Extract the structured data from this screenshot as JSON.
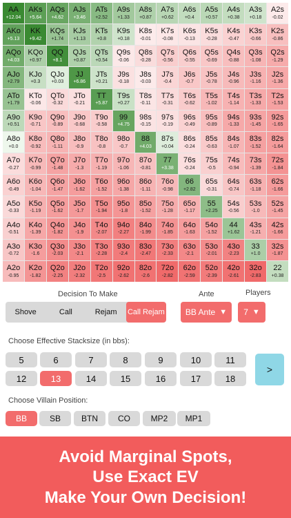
{
  "hands": [
    [
      "AA",
      "+12.04"
    ],
    [
      "AKs",
      "+5.64"
    ],
    [
      "AQs",
      "+4.62"
    ],
    [
      "AJs",
      "+3.46"
    ],
    [
      "ATs",
      "+2.52"
    ],
    [
      "A9s",
      "+1.33"
    ],
    [
      "A8s",
      "+0.87"
    ],
    [
      "A7s",
      "+0.62"
    ],
    [
      "A6s",
      "+0.4"
    ],
    [
      "A5s",
      "+0.57"
    ],
    [
      "A4s",
      "+0.38"
    ],
    [
      "A3s",
      "+0.18"
    ],
    [
      "A2s",
      "-0.02"
    ],
    [
      "AKo",
      "+5.13"
    ],
    [
      "KK",
      "+9.42"
    ],
    [
      "KQs",
      "+1.74"
    ],
    [
      "KJs",
      "+1.13"
    ],
    [
      "KTs",
      "+0.8"
    ],
    [
      "K9s",
      "+0.18"
    ],
    [
      "K8s",
      "-0.01"
    ],
    [
      "K7s",
      "-0.08"
    ],
    [
      "K6s",
      "-0.13"
    ],
    [
      "K5s",
      "-0.28"
    ],
    [
      "K4s",
      "-0.47"
    ],
    [
      "K3s",
      "-0.66"
    ],
    [
      "K2s",
      "-0.86"
    ],
    [
      "AQo",
      "+4.03"
    ],
    [
      "KQo",
      "+0.97"
    ],
    [
      "QQ",
      "+8.1"
    ],
    [
      "QJs",
      "+0.87"
    ],
    [
      "QTs",
      "+0.54"
    ],
    [
      "Q9s",
      "-0.06"
    ],
    [
      "Q8s",
      "-0.28"
    ],
    [
      "Q7s",
      "-0.56"
    ],
    [
      "Q6s",
      "-0.55"
    ],
    [
      "Q5s",
      "-0.69"
    ],
    [
      "Q4s",
      "-0.88"
    ],
    [
      "Q3s",
      "-1.08"
    ],
    [
      "Q2s",
      "-1.29"
    ],
    [
      "AJo",
      "+2.79"
    ],
    [
      "KJo",
      "+0.3"
    ],
    [
      "QJo",
      "+0.03"
    ],
    [
      "JJ",
      "+6.86"
    ],
    [
      "JTs",
      "+0.21"
    ],
    [
      "J9s",
      "-0.18"
    ],
    [
      "J8s",
      "-0.03"
    ],
    [
      "J7s",
      "-0.4"
    ],
    [
      "J6s",
      "-0.7"
    ],
    [
      "J5s",
      "-0.78"
    ],
    [
      "J4s",
      "-0.96"
    ],
    [
      "J3s",
      "-1.16"
    ],
    [
      "J2s",
      "-1.36"
    ],
    [
      "ATo",
      "+1.79"
    ],
    [
      "KTo",
      "-0.06"
    ],
    [
      "QTo",
      "-0.32"
    ],
    [
      "JTo",
      "-0.21"
    ],
    [
      "TT",
      "+5.87"
    ],
    [
      "T9s",
      "+0.27"
    ],
    [
      "T8s",
      "-0.11"
    ],
    [
      "T7s",
      "-0.31"
    ],
    [
      "T6s",
      "-0.62"
    ],
    [
      "T5s",
      "-1.02"
    ],
    [
      "T4s",
      "-1.14"
    ],
    [
      "T3s",
      "-1.33"
    ],
    [
      "T2s",
      "-1.53"
    ],
    [
      "A9o",
      "+0.51"
    ],
    [
      "K9o",
      "-0.71"
    ],
    [
      "Q9o",
      "-0.89"
    ],
    [
      "J9o",
      "-0.68"
    ],
    [
      "T9o",
      "-0.58"
    ],
    [
      "99",
      "+4.75"
    ],
    [
      "98s",
      "-0.15"
    ],
    [
      "97s",
      "-0.19"
    ],
    [
      "96s",
      "-0.49"
    ],
    [
      "95s",
      "-0.89"
    ],
    [
      "94s",
      "-1.33"
    ],
    [
      "93s",
      "-1.45"
    ],
    [
      "92s",
      "-1.65"
    ],
    [
      "A8o",
      "+0.0"
    ],
    [
      "K8o",
      "-0.92"
    ],
    [
      "Q8o",
      "-1.11"
    ],
    [
      "J8o",
      "-0.9"
    ],
    [
      "T8o",
      "-0.8"
    ],
    [
      "98o",
      "-0.7"
    ],
    [
      "88",
      "+4.03"
    ],
    [
      "87s",
      "+0.04"
    ],
    [
      "86s",
      "-0.24"
    ],
    [
      "85s",
      "-0.63"
    ],
    [
      "84s",
      "-1.07"
    ],
    [
      "83s",
      "-1.52"
    ],
    [
      "82s",
      "-1.64"
    ],
    [
      "A7o",
      "-0.27"
    ],
    [
      "K7o",
      "-0.99"
    ],
    [
      "Q7o",
      "-1.48"
    ],
    [
      "J7o",
      "-1.3"
    ],
    [
      "T7o",
      "-1.19"
    ],
    [
      "97o",
      "-1.06"
    ],
    [
      "87o",
      "-0.81"
    ],
    [
      "77",
      "+3.38"
    ],
    [
      "76s",
      "-0.24"
    ],
    [
      "75s",
      "-0.5"
    ],
    [
      "74s",
      "-0.94"
    ],
    [
      "73s",
      "-1.39"
    ],
    [
      "72s",
      "-1.84"
    ],
    [
      "A6o",
      "-0.49"
    ],
    [
      "K6o",
      "-1.04"
    ],
    [
      "Q6o",
      "-1.47"
    ],
    [
      "J6o",
      "-1.62"
    ],
    [
      "T6o",
      "-1.52"
    ],
    [
      "96o",
      "-1.38"
    ],
    [
      "86o",
      "-1.11"
    ],
    [
      "76o",
      "-0.98"
    ],
    [
      "66",
      "+2.82"
    ],
    [
      "65s",
      "-0.31"
    ],
    [
      "64s",
      "-0.74"
    ],
    [
      "63s",
      "-1.18"
    ],
    [
      "62s",
      "-1.66"
    ],
    [
      "A5o",
      "-0.33"
    ],
    [
      "K5o",
      "-1.19"
    ],
    [
      "Q5o",
      "-1.62"
    ],
    [
      "J5o",
      "-1.7"
    ],
    [
      "T5o",
      "-1.94"
    ],
    [
      "95o",
      "-1.8"
    ],
    [
      "85o",
      "-1.52"
    ],
    [
      "75o",
      "-1.28"
    ],
    [
      "65o",
      "-1.17"
    ],
    [
      "55",
      "+2.25"
    ],
    [
      "54s",
      "-0.56"
    ],
    [
      "53s",
      "-1.0"
    ],
    [
      "52s",
      "-1.45"
    ],
    [
      "A4o",
      "-0.51"
    ],
    [
      "K4o",
      "-1.39"
    ],
    [
      "Q4o",
      "-1.82"
    ],
    [
      "J4o",
      "-1.9"
    ],
    [
      "T4o",
      "-2.07"
    ],
    [
      "94o",
      "-2.27"
    ],
    [
      "84o",
      "-1.99"
    ],
    [
      "74o",
      "-1.85"
    ],
    [
      "64o",
      "-1.63"
    ],
    [
      "54o",
      "-1.52"
    ],
    [
      "44",
      "+1.62"
    ],
    [
      "43s",
      "-1.21"
    ],
    [
      "42s",
      "-1.66"
    ],
    [
      "A3o",
      "-0.72"
    ],
    [
      "K3o",
      "-1.6"
    ],
    [
      "Q3o",
      "-2.03"
    ],
    [
      "J3o",
      "-2.1"
    ],
    [
      "T3o",
      "-2.28"
    ],
    [
      "93o",
      "-2.4"
    ],
    [
      "83o",
      "-2.47"
    ],
    [
      "73o",
      "-2.33"
    ],
    [
      "63o",
      "-2.1"
    ],
    [
      "53o",
      "-2.01"
    ],
    [
      "43o",
      "-2.23"
    ],
    [
      "33",
      "+1.0"
    ],
    [
      "32s",
      "-1.87"
    ],
    [
      "A2o",
      "-0.95"
    ],
    [
      "K2o",
      "-1.82"
    ],
    [
      "Q2o",
      "-2.25"
    ],
    [
      "J2o",
      "-2.32"
    ],
    [
      "T2o",
      "-2.5"
    ],
    [
      "92o",
      "-2.62"
    ],
    [
      "82o",
      "-2.6"
    ],
    [
      "72o",
      "-2.82"
    ],
    [
      "62o",
      "-2.59"
    ],
    [
      "52o",
      "-2.39"
    ],
    [
      "42o",
      "-2.61"
    ],
    [
      "32o",
      "-2.83"
    ],
    [
      "22",
      "+0.38"
    ]
  ],
  "labels": {
    "decision": "Decision To Make",
    "ante": "Ante",
    "players": "Players",
    "stacksize": "Choose Effective Stacksize (in bbs):",
    "villain": "Choose Villain Position:"
  },
  "decision_options": [
    "Shove",
    "Call",
    "Rejam",
    "Call Rejam"
  ],
  "decision_selected": "Call Rejam",
  "ante_value": "BB Ante",
  "players_value": "7",
  "dropdown_glyph": "▼",
  "stacks": [
    "5",
    "6",
    "7",
    "8",
    "9",
    "10",
    "11",
    "12",
    "13",
    "14",
    "15",
    "16",
    "17",
    "18"
  ],
  "stack_selected": "13",
  "next_label": ">",
  "positions": [
    "BB",
    "SB",
    "BTN",
    "CO",
    "MP2",
    "MP1"
  ],
  "position_selected": "BB",
  "banner": [
    "Avoid Marginal Spots,",
    "Use Exact EV",
    "Make Your Own Decision!"
  ],
  "colors": {
    "accent": "#f26c6c",
    "banner": "#f25c5c",
    "positive_strong": "#3a8a32",
    "negative_strong": "#f06a6a",
    "button_gray": "#d9d9d9",
    "next_button": "#8fd7e6"
  }
}
